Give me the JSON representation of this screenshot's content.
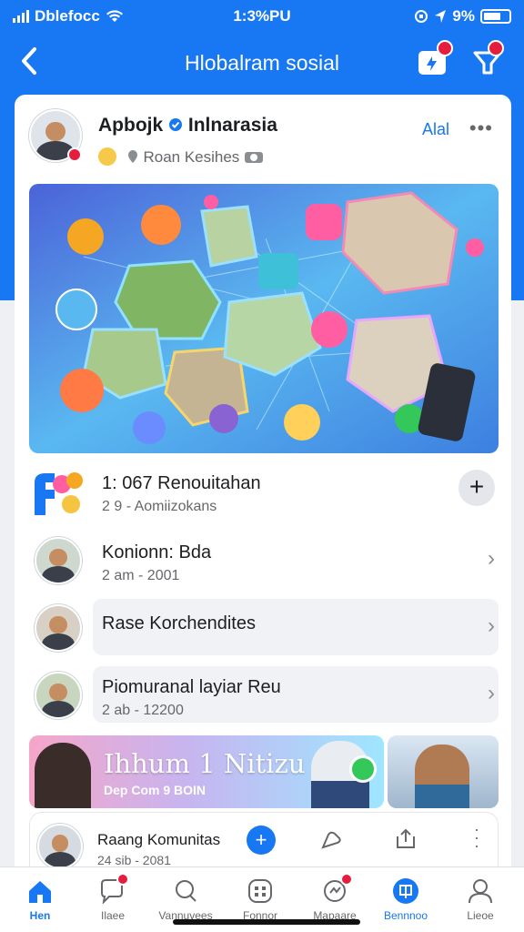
{
  "status": {
    "carrier": "Dblefocc",
    "time": "1:3%PU",
    "battery": "9%"
  },
  "nav": {
    "title": "Hlobalram sosial",
    "badge_left": "",
    "badge_right": ""
  },
  "header": {
    "name": "Apbojk",
    "name_tail": "Inlnarasia",
    "subtitle": "Roan Kesihes",
    "action": "Alal"
  },
  "list": [
    {
      "title": "1: 067 Renouitahan",
      "subtitle": "2 9 - Aomiizokans"
    },
    {
      "title": "Konionn: Bda",
      "subtitle": "2 am - 2001"
    },
    {
      "title": "Rase Korchendites",
      "subtitle": ""
    },
    {
      "title": "Piomuranal  layiar Reu",
      "subtitle": "2 ab - 12200"
    }
  ],
  "banner": {
    "title": "Ihhum 1 Nitizu",
    "meta": "Dep   Com   9 BOIN"
  },
  "post": {
    "title": "Raang Komunitas",
    "subtitle": "24 sib - 2081"
  },
  "tabs": [
    {
      "label": "Hen",
      "active": true
    },
    {
      "label": "Ilaee"
    },
    {
      "label": "Vannuvees"
    },
    {
      "label": "Fonnor"
    },
    {
      "label": "Mapaare"
    },
    {
      "label": "Bennnoo"
    },
    {
      "label": "Lieoe"
    }
  ],
  "colors": {
    "brand": "#1877f2",
    "badge": "#e41e3f"
  }
}
